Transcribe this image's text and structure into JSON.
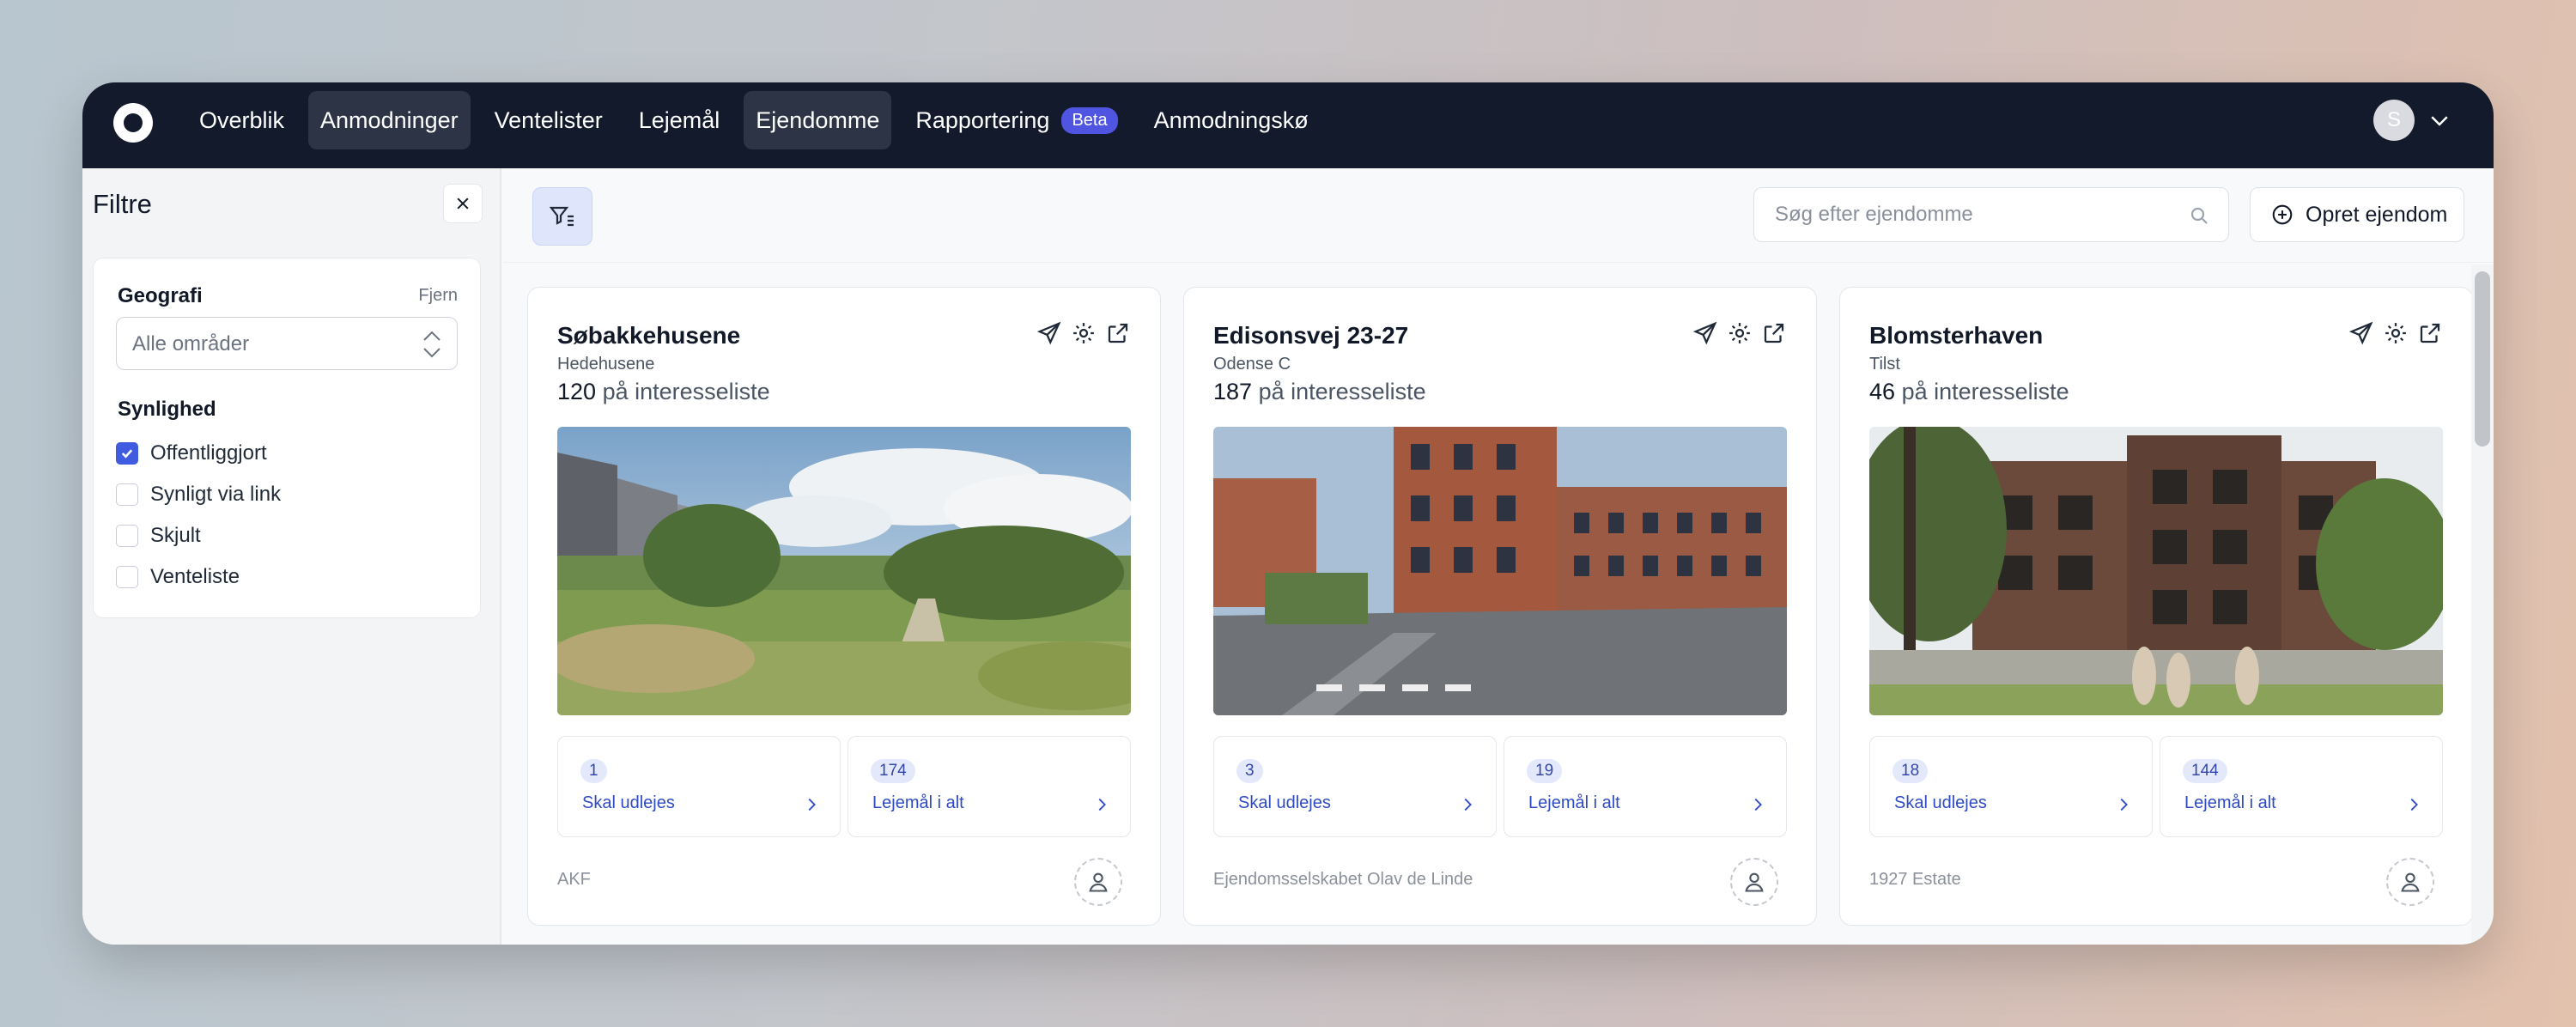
{
  "nav": {
    "items": [
      {
        "label": "Overblik",
        "active": false
      },
      {
        "label": "Anmodninger",
        "active": true
      },
      {
        "label": "Ventelister",
        "active": false
      },
      {
        "label": "Lejemål",
        "active": false
      },
      {
        "label": "Ejendomme",
        "active": true
      },
      {
        "label": "Rapportering",
        "active": false,
        "badge": "Beta"
      },
      {
        "label": "Anmodningskø",
        "active": false
      }
    ],
    "user_initial": "S"
  },
  "filters": {
    "title": "Filtre",
    "geography": {
      "label": "Geografi",
      "remove": "Fjern",
      "select_value": "Alle områder"
    },
    "visibility": {
      "label": "Synlighed",
      "options": [
        {
          "label": "Offentliggjort",
          "checked": true
        },
        {
          "label": "Synligt via link",
          "checked": false
        },
        {
          "label": "Skjult",
          "checked": false
        },
        {
          "label": "Venteliste",
          "checked": false
        }
      ]
    }
  },
  "toolbar": {
    "search_placeholder": "Søg efter ejendomme",
    "create_label": "Opret ejendom"
  },
  "interest_suffix": "på interesseliste",
  "properties": [
    {
      "name": "Søbakkehusene",
      "city": "Hedehusene",
      "interest_count": "120",
      "to_rent": {
        "count": "1",
        "label": "Skal udlejes"
      },
      "total": {
        "count": "174",
        "label": "Lejemål i alt"
      },
      "owner": "AKF"
    },
    {
      "name": "Edisonsvej 23-27",
      "city": "Odense C",
      "interest_count": "187",
      "to_rent": {
        "count": "3",
        "label": "Skal udlejes"
      },
      "total": {
        "count": "19",
        "label": "Lejemål i alt"
      },
      "owner": "Ejendomsselskabet Olav de Linde"
    },
    {
      "name": "Blomsterhaven",
      "city": "Tilst",
      "interest_count": "46",
      "to_rent": {
        "count": "18",
        "label": "Skal udlejes"
      },
      "total": {
        "count": "144",
        "label": "Lejemål i alt"
      },
      "owner": "1927 Estate"
    }
  ],
  "colors": {
    "nav_bg": "#131a2c",
    "accent": "#3f5be0",
    "badge": "#4f55e0",
    "link": "#2f4bc4"
  }
}
